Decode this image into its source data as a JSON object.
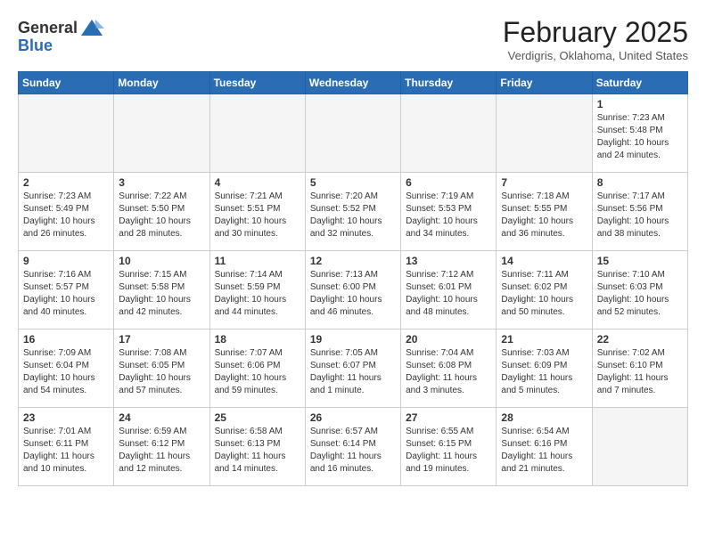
{
  "header": {
    "logo_general": "General",
    "logo_blue": "Blue",
    "month_title": "February 2025",
    "location": "Verdigris, Oklahoma, United States"
  },
  "weekdays": [
    "Sunday",
    "Monday",
    "Tuesday",
    "Wednesday",
    "Thursday",
    "Friday",
    "Saturday"
  ],
  "weeks": [
    [
      {
        "day": "",
        "info": ""
      },
      {
        "day": "",
        "info": ""
      },
      {
        "day": "",
        "info": ""
      },
      {
        "day": "",
        "info": ""
      },
      {
        "day": "",
        "info": ""
      },
      {
        "day": "",
        "info": ""
      },
      {
        "day": "1",
        "info": "Sunrise: 7:23 AM\nSunset: 5:48 PM\nDaylight: 10 hours and 24 minutes."
      }
    ],
    [
      {
        "day": "2",
        "info": "Sunrise: 7:23 AM\nSunset: 5:49 PM\nDaylight: 10 hours and 26 minutes."
      },
      {
        "day": "3",
        "info": "Sunrise: 7:22 AM\nSunset: 5:50 PM\nDaylight: 10 hours and 28 minutes."
      },
      {
        "day": "4",
        "info": "Sunrise: 7:21 AM\nSunset: 5:51 PM\nDaylight: 10 hours and 30 minutes."
      },
      {
        "day": "5",
        "info": "Sunrise: 7:20 AM\nSunset: 5:52 PM\nDaylight: 10 hours and 32 minutes."
      },
      {
        "day": "6",
        "info": "Sunrise: 7:19 AM\nSunset: 5:53 PM\nDaylight: 10 hours and 34 minutes."
      },
      {
        "day": "7",
        "info": "Sunrise: 7:18 AM\nSunset: 5:55 PM\nDaylight: 10 hours and 36 minutes."
      },
      {
        "day": "8",
        "info": "Sunrise: 7:17 AM\nSunset: 5:56 PM\nDaylight: 10 hours and 38 minutes."
      }
    ],
    [
      {
        "day": "9",
        "info": "Sunrise: 7:16 AM\nSunset: 5:57 PM\nDaylight: 10 hours and 40 minutes."
      },
      {
        "day": "10",
        "info": "Sunrise: 7:15 AM\nSunset: 5:58 PM\nDaylight: 10 hours and 42 minutes."
      },
      {
        "day": "11",
        "info": "Sunrise: 7:14 AM\nSunset: 5:59 PM\nDaylight: 10 hours and 44 minutes."
      },
      {
        "day": "12",
        "info": "Sunrise: 7:13 AM\nSunset: 6:00 PM\nDaylight: 10 hours and 46 minutes."
      },
      {
        "day": "13",
        "info": "Sunrise: 7:12 AM\nSunset: 6:01 PM\nDaylight: 10 hours and 48 minutes."
      },
      {
        "day": "14",
        "info": "Sunrise: 7:11 AM\nSunset: 6:02 PM\nDaylight: 10 hours and 50 minutes."
      },
      {
        "day": "15",
        "info": "Sunrise: 7:10 AM\nSunset: 6:03 PM\nDaylight: 10 hours and 52 minutes."
      }
    ],
    [
      {
        "day": "16",
        "info": "Sunrise: 7:09 AM\nSunset: 6:04 PM\nDaylight: 10 hours and 54 minutes."
      },
      {
        "day": "17",
        "info": "Sunrise: 7:08 AM\nSunset: 6:05 PM\nDaylight: 10 hours and 57 minutes."
      },
      {
        "day": "18",
        "info": "Sunrise: 7:07 AM\nSunset: 6:06 PM\nDaylight: 10 hours and 59 minutes."
      },
      {
        "day": "19",
        "info": "Sunrise: 7:05 AM\nSunset: 6:07 PM\nDaylight: 11 hours and 1 minute."
      },
      {
        "day": "20",
        "info": "Sunrise: 7:04 AM\nSunset: 6:08 PM\nDaylight: 11 hours and 3 minutes."
      },
      {
        "day": "21",
        "info": "Sunrise: 7:03 AM\nSunset: 6:09 PM\nDaylight: 11 hours and 5 minutes."
      },
      {
        "day": "22",
        "info": "Sunrise: 7:02 AM\nSunset: 6:10 PM\nDaylight: 11 hours and 7 minutes."
      }
    ],
    [
      {
        "day": "23",
        "info": "Sunrise: 7:01 AM\nSunset: 6:11 PM\nDaylight: 11 hours and 10 minutes."
      },
      {
        "day": "24",
        "info": "Sunrise: 6:59 AM\nSunset: 6:12 PM\nDaylight: 11 hours and 12 minutes."
      },
      {
        "day": "25",
        "info": "Sunrise: 6:58 AM\nSunset: 6:13 PM\nDaylight: 11 hours and 14 minutes."
      },
      {
        "day": "26",
        "info": "Sunrise: 6:57 AM\nSunset: 6:14 PM\nDaylight: 11 hours and 16 minutes."
      },
      {
        "day": "27",
        "info": "Sunrise: 6:55 AM\nSunset: 6:15 PM\nDaylight: 11 hours and 19 minutes."
      },
      {
        "day": "28",
        "info": "Sunrise: 6:54 AM\nSunset: 6:16 PM\nDaylight: 11 hours and 21 minutes."
      },
      {
        "day": "",
        "info": ""
      }
    ]
  ]
}
